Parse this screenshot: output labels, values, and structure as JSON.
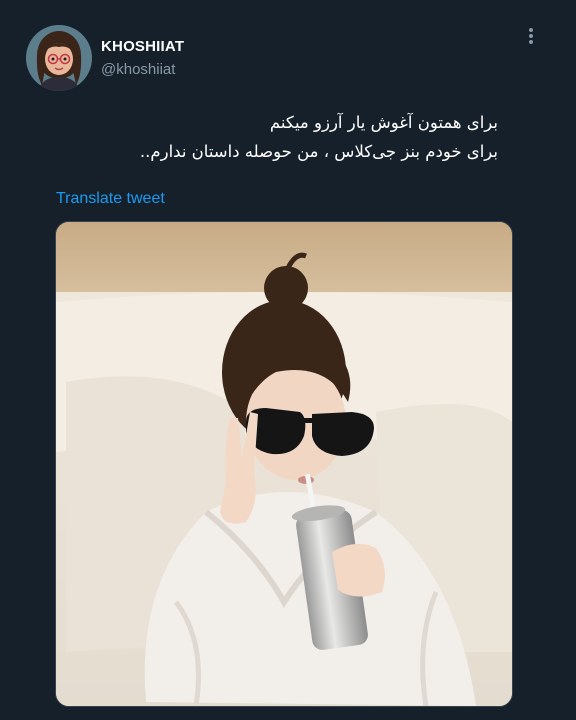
{
  "tweet": {
    "author": {
      "display_name": "KHOSHIIAT",
      "handle": "@khoshiiat",
      "avatar_icon": "avatar-illustration"
    },
    "more_icon": "more-vertical-icon",
    "text_lines": [
      "برای همتون آغوش یار آرزو میکنم",
      "برای خودم بنز جی‌کلاس ، من حوصله داستان ندارم.."
    ],
    "translate_label": "Translate tweet",
    "media": {
      "kind": "photo",
      "subject": "child-in-bathrobe-with-sunglasses-and-can"
    }
  },
  "colors": {
    "background": "#15202b",
    "text": "#ffffff",
    "muted": "#8899a6",
    "link": "#1d9bf0"
  }
}
